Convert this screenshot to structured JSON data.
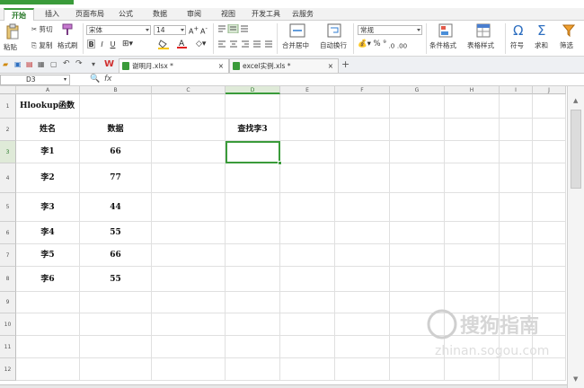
{
  "tabs": [
    "开始",
    "插入",
    "页面布局",
    "公式",
    "数据",
    "审阅",
    "视图",
    "开发工具",
    "云服务"
  ],
  "ribbon": {
    "paste": "粘贴",
    "cut": "剪切",
    "copy": "复制",
    "format_painter": "格式刷",
    "font_name": "宋体",
    "font_size": "14",
    "merge_center": "合并居中",
    "wrap_text": "自动换行",
    "number_format": "常规",
    "conditional_format": "条件格式",
    "table_style": "表格样式",
    "symbol": "符号",
    "sum": "求和",
    "filter": "筛选"
  },
  "doc_tabs": [
    {
      "name": "谢明月.xlsx *",
      "active": true
    },
    {
      "name": "excel实例.xls *",
      "active": false
    }
  ],
  "formula_bar": {
    "cell_ref": "D3",
    "fx": "fx",
    "formula": ""
  },
  "columns": [
    "A",
    "B",
    "C",
    "D",
    "E",
    "F",
    "G",
    "H",
    "I",
    "J"
  ],
  "rows": [
    "1",
    "2",
    "3",
    "4",
    "5",
    "6",
    "7",
    "8",
    "9",
    "10",
    "11",
    "12"
  ],
  "active_cell": "D3",
  "cells": {
    "A1": "Hlookup函数",
    "A2": "姓名",
    "B2": "数据",
    "D2": "查找李3",
    "A3": "李1",
    "B3": "66",
    "A4": "李2",
    "B4": "77",
    "A5": "李3",
    "B5": "44",
    "A6": "李4",
    "B6": "55",
    "A7": "李5",
    "B7": "66",
    "A8": "李6",
    "B8": "55"
  },
  "watermark": {
    "brand": "搜狗指南",
    "url": "zhinan.sogou.com"
  }
}
